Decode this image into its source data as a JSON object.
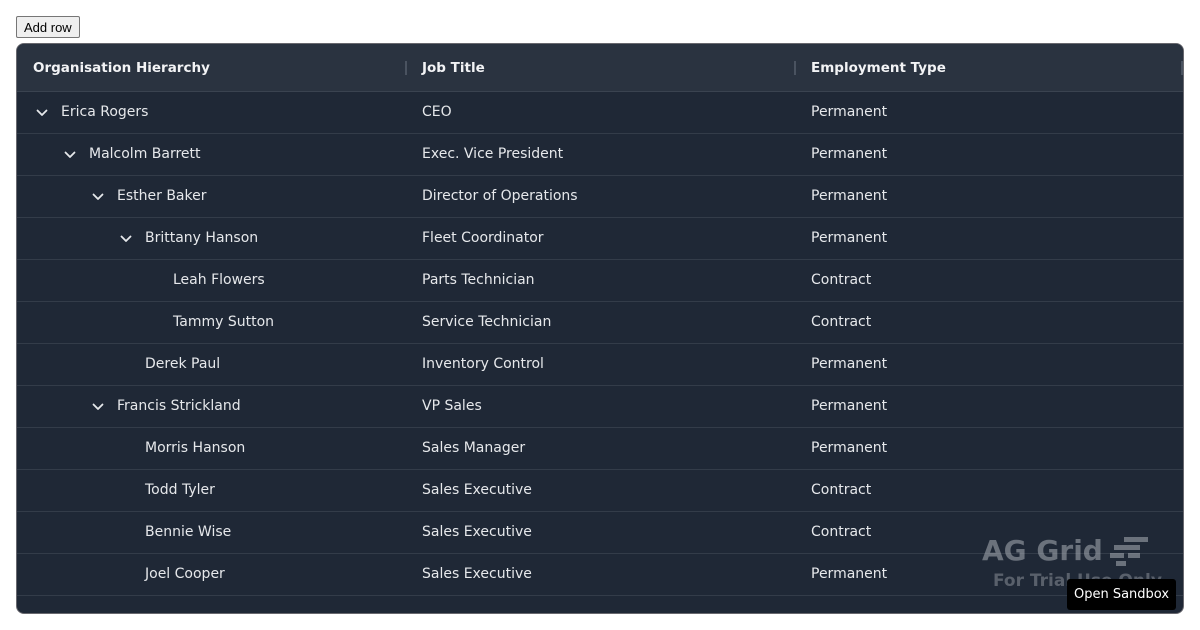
{
  "toolbar": {
    "add_row_label": "Add row"
  },
  "grid": {
    "columns": [
      "Organisation Hierarchy",
      "Job Title",
      "Employment Type"
    ],
    "rows": [
      {
        "name": "Erica Rogers",
        "level": 0,
        "expanded": true,
        "job": "CEO",
        "type": "Permanent"
      },
      {
        "name": "Malcolm Barrett",
        "level": 1,
        "expanded": true,
        "job": "Exec. Vice President",
        "type": "Permanent"
      },
      {
        "name": "Esther Baker",
        "level": 2,
        "expanded": true,
        "job": "Director of Operations",
        "type": "Permanent"
      },
      {
        "name": "Brittany Hanson",
        "level": 3,
        "expanded": true,
        "job": "Fleet Coordinator",
        "type": "Permanent"
      },
      {
        "name": "Leah Flowers",
        "level": 4,
        "expanded": false,
        "job": "Parts Technician",
        "type": "Contract"
      },
      {
        "name": "Tammy Sutton",
        "level": 4,
        "expanded": false,
        "job": "Service Technician",
        "type": "Contract"
      },
      {
        "name": "Derek Paul",
        "level": 3,
        "expanded": false,
        "job": "Inventory Control",
        "type": "Permanent"
      },
      {
        "name": "Francis Strickland",
        "level": 2,
        "expanded": true,
        "job": "VP Sales",
        "type": "Permanent"
      },
      {
        "name": "Morris Hanson",
        "level": 3,
        "expanded": false,
        "job": "Sales Manager",
        "type": "Permanent"
      },
      {
        "name": "Todd Tyler",
        "level": 3,
        "expanded": false,
        "job": "Sales Executive",
        "type": "Contract"
      },
      {
        "name": "Bennie Wise",
        "level": 3,
        "expanded": false,
        "job": "Sales Executive",
        "type": "Contract"
      },
      {
        "name": "Joel Cooper",
        "level": 3,
        "expanded": false,
        "job": "Sales Executive",
        "type": "Permanent"
      }
    ]
  },
  "watermark": {
    "title": "AG Grid",
    "subtitle": "For Trial Use Only"
  },
  "sandbox": {
    "label": "Open Sandbox"
  },
  "icons": {
    "expand": "chevron-down-icon",
    "logo": "ag-grid-logo-icon"
  },
  "colors": {
    "grid_bg": "#1f2836",
    "header_bg": "#2a3340",
    "text": "#e6e8eb"
  }
}
